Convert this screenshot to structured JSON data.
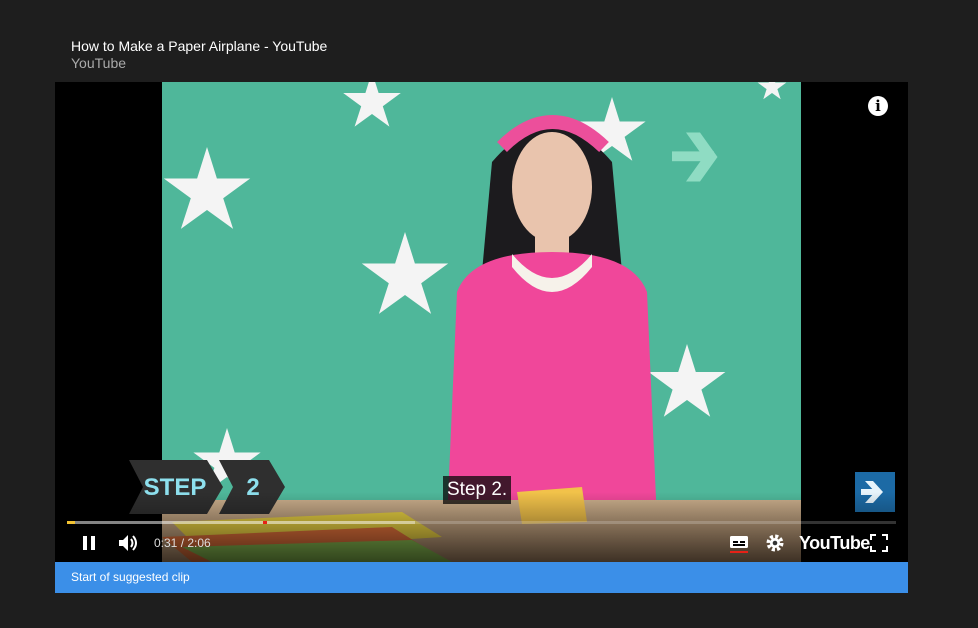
{
  "header": {
    "title": "How to Make a Paper Airplane - YouTube",
    "channel": "YouTube"
  },
  "video": {
    "step_word": "STEP",
    "step_number": "2",
    "caption": "Step 2.",
    "info_icon": "info-icon",
    "info_glyph": "i",
    "brand_icon": "howcast-logo-icon"
  },
  "player": {
    "played_fraction": 0.01,
    "buffered_fraction": 0.42,
    "current_time": "0:31",
    "time_separator": " / ",
    "duration": "2:06",
    "logo": "YouTube",
    "icons": [
      "pause-icon",
      "volume-icon",
      "subtitles-icon",
      "settings-icon",
      "fullscreen-icon"
    ]
  },
  "clip": {
    "label": "Start of suggested clip"
  },
  "colors": {
    "background": "#1e1e1e",
    "backdrop": "#4fb79a",
    "progress_played": "#f1c232",
    "progress_marker": "#e62117",
    "clip_bar": "#3b8fe8"
  }
}
